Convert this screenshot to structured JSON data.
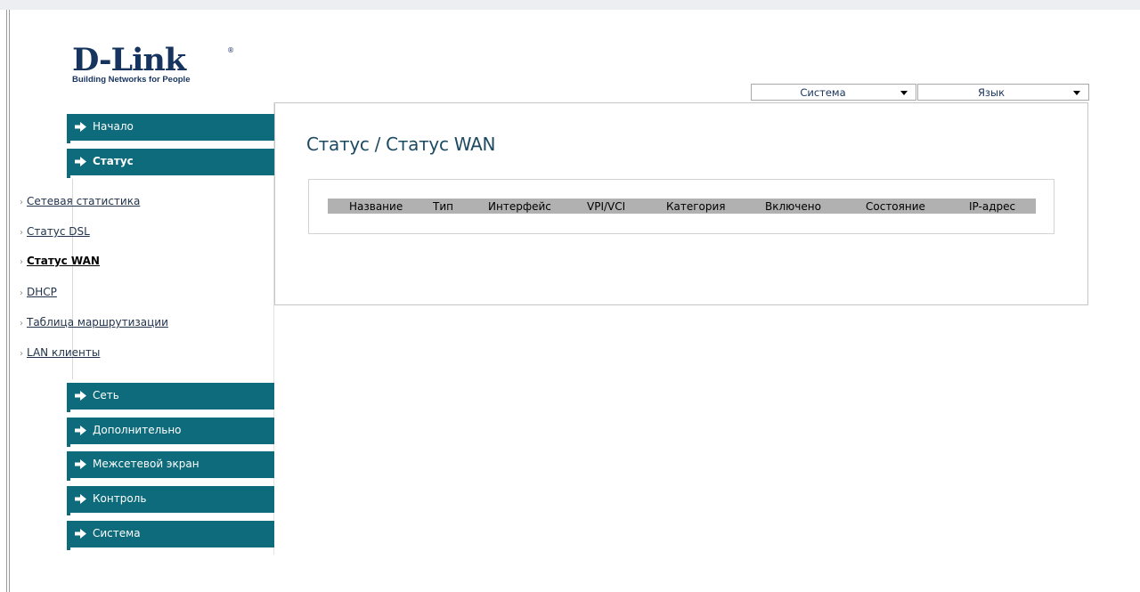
{
  "brand": {
    "logo_text": "D-Link",
    "registered": "®",
    "tagline": "Building Networks for People"
  },
  "header": {
    "system_dropdown": "Система",
    "language_dropdown": "Язык"
  },
  "sidebar": {
    "top_items": [
      {
        "label": "Начало"
      },
      {
        "label": "Статус"
      }
    ],
    "status_submenu": [
      {
        "label": "Сетевая статистика"
      },
      {
        "label": "Статус DSL"
      },
      {
        "label": "Статус WAN"
      },
      {
        "label": "DHCP"
      },
      {
        "label": "Таблица маршрутизации"
      },
      {
        "label": "LAN клиенты"
      }
    ],
    "bottom_items": [
      {
        "label": "Сеть"
      },
      {
        "label": "Дополнительно"
      },
      {
        "label": "Межсетевой экран"
      },
      {
        "label": "Контроль"
      },
      {
        "label": "Система"
      }
    ],
    "active_item": "Статус",
    "active_subitem": "Статус WAN"
  },
  "main": {
    "title": "Статус / Статус WAN",
    "table": {
      "columns": [
        "Название",
        "Тип",
        "Интерфейс",
        "VPI/VCI",
        "Категория",
        "Включено",
        "Состояние",
        "IP-адрес"
      ],
      "rows": []
    }
  },
  "colors": {
    "menu_bar": "#0d6b7b",
    "title": "#1d4a63",
    "table_header": "#b1b1b1",
    "brand": "#17345f"
  },
  "icons": {
    "menu_arrow": "arrow-right-icon",
    "submenu_chevron": "chevron-right-icon",
    "dropdown": "chevron-down-icon"
  }
}
